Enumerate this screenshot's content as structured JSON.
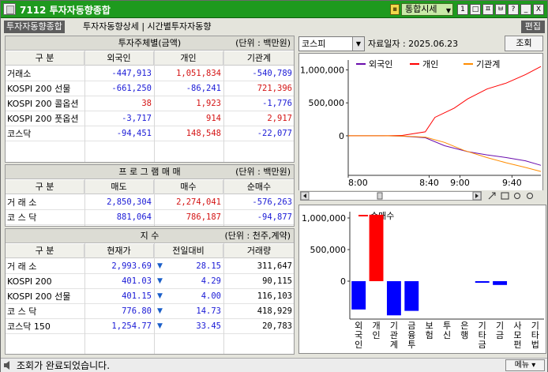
{
  "window": {
    "title": "7112 투자자동향종합",
    "combo": "통합시세",
    "controls": [
      "1",
      "□",
      "ㅍ",
      "ㅂ",
      "?",
      "_",
      "□",
      "X"
    ]
  },
  "tabs": {
    "active": "투자자동향종합",
    "rest": "투자자동향상세 | 시간별투자자동향",
    "edit": "편집"
  },
  "investors": {
    "title": "투자주체별(금액)",
    "unit": "(단위 : 백만원)",
    "headers": [
      "구 분",
      "외국인",
      "개인",
      "기관계"
    ],
    "rows": [
      {
        "label": "거래소",
        "v": [
          "-447,913",
          "1,051,834",
          "-540,789"
        ],
        "c": [
          "b",
          "r",
          "b"
        ]
      },
      {
        "label": "KOSPI 200 선물",
        "v": [
          "-661,250",
          "-86,241",
          "721,396"
        ],
        "c": [
          "b",
          "b",
          "r"
        ]
      },
      {
        "label": "KOSPI 200 콜옵션",
        "v": [
          "38",
          "1,923",
          "-1,776"
        ],
        "c": [
          "r",
          "r",
          "b"
        ]
      },
      {
        "label": "KOSPI 200 풋옵션",
        "v": [
          "-3,717",
          "914",
          "2,917"
        ],
        "c": [
          "b",
          "r",
          "r"
        ]
      },
      {
        "label": "코스닥",
        "v": [
          "-94,451",
          "148,548",
          "-22,077"
        ],
        "c": [
          "b",
          "r",
          "b"
        ]
      }
    ]
  },
  "program": {
    "title": "프 로 그 램 매 매",
    "unit": "(단위 : 백만원)",
    "headers": [
      "구 분",
      "매도",
      "매수",
      "순매수"
    ],
    "rows": [
      {
        "label": "거 래 소",
        "v": [
          "2,850,304",
          "2,274,041",
          "-576,263"
        ],
        "c": [
          "b",
          "r",
          "b"
        ]
      },
      {
        "label": "코 스 닥",
        "v": [
          "881,064",
          "786,187",
          "-94,877"
        ],
        "c": [
          "b",
          "r",
          "b"
        ]
      }
    ]
  },
  "index": {
    "title": "지 수",
    "unit": "(단위 : 천주,계약)",
    "headers": [
      "구 분",
      "현재가",
      "전일대비",
      "거래량"
    ],
    "rows": [
      {
        "label": "거 래 소",
        "v": [
          "2,993.69",
          "28.15",
          "311,647"
        ]
      },
      {
        "label": "KOSPI 200",
        "v": [
          "401.03",
          "4.29",
          "90,115"
        ]
      },
      {
        "label": "KOSPI 200 선물",
        "v": [
          "401.15",
          "4.00",
          "116,103"
        ]
      },
      {
        "label": "코 스 닥",
        "v": [
          "776.80",
          "14.73",
          "418,929"
        ]
      },
      {
        "label": "코스닥 150",
        "v": [
          "1,254.77",
          "33.45",
          "20,783"
        ]
      }
    ]
  },
  "toolbar": {
    "market": "코스피",
    "date_label": "자료일자 : 2025.06.23",
    "query": "조회"
  },
  "status": {
    "message": "조회가 완료되었습니다.",
    "menu": "메뉴 ▾"
  },
  "chart_data": [
    {
      "type": "line",
      "x": [
        "8:00",
        "8:40",
        "9:00",
        "9:40"
      ],
      "yticks": [
        "1,000,000",
        "500,000",
        "0"
      ],
      "ylim": [
        -600000,
        1150000
      ],
      "series": [
        {
          "name": "외국인",
          "color": "#6a0dad",
          "points": [
            [
              0,
              0
            ],
            [
              0.18,
              0
            ],
            [
              0.28,
              -5000
            ],
            [
              0.4,
              -30000
            ],
            [
              0.5,
              -150000
            ],
            [
              0.62,
              -240000
            ],
            [
              0.72,
              -290000
            ],
            [
              0.82,
              -330000
            ],
            [
              0.92,
              -380000
            ],
            [
              1,
              -447913
            ]
          ]
        },
        {
          "name": "개인",
          "color": "#ff0000",
          "points": [
            [
              0,
              0
            ],
            [
              0.18,
              0
            ],
            [
              0.28,
              5000
            ],
            [
              0.4,
              60000
            ],
            [
              0.45,
              280000
            ],
            [
              0.55,
              420000
            ],
            [
              0.62,
              560000
            ],
            [
              0.72,
              710000
            ],
            [
              0.82,
              800000
            ],
            [
              0.92,
              930000
            ],
            [
              1,
              1051834
            ]
          ]
        },
        {
          "name": "기관계",
          "color": "#ff8c00",
          "points": [
            [
              0,
              0
            ],
            [
              0.18,
              0
            ],
            [
              0.28,
              -3000
            ],
            [
              0.4,
              -20000
            ],
            [
              0.5,
              -100000
            ],
            [
              0.6,
              -220000
            ],
            [
              0.72,
              -330000
            ],
            [
              0.82,
              -410000
            ],
            [
              0.92,
              -480000
            ],
            [
              1,
              -540789
            ]
          ]
        }
      ]
    },
    {
      "type": "bar",
      "legend": "순매수",
      "categories": [
        "외국인",
        "개인",
        "기관계",
        "금융투",
        "보험",
        "투신",
        "은행",
        "기타금",
        "기금",
        "사모펀",
        "기타법"
      ],
      "values": [
        -447913,
        1051834,
        -540789,
        -470000,
        0,
        0,
        0,
        -18000,
        -60000,
        0,
        0
      ],
      "colors": [
        "#0000ff",
        "#ff0000",
        "#0000ff",
        "#0000ff",
        "#0000ff",
        "#0000ff",
        "#0000ff",
        "#0000ff",
        "#0000ff",
        "#0000ff",
        "#0000ff"
      ],
      "yticks": [
        "1,000,000",
        "500,000",
        "0"
      ],
      "ylim": [
        -600000,
        1100000
      ]
    }
  ]
}
